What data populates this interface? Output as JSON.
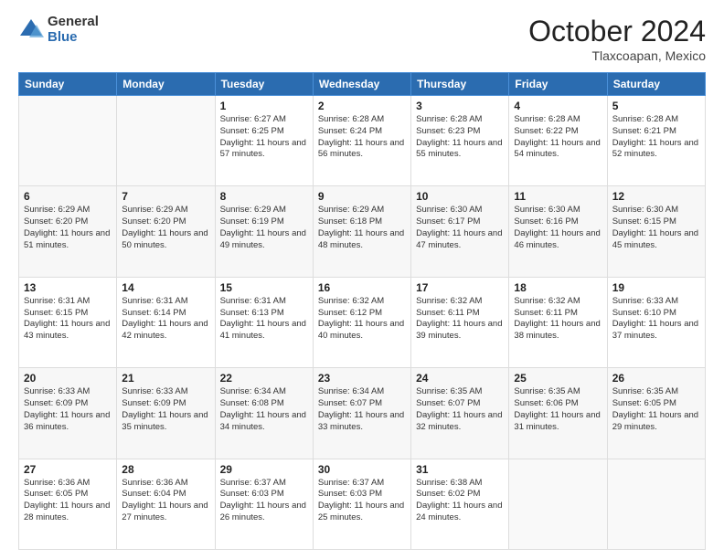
{
  "logo": {
    "general": "General",
    "blue": "Blue"
  },
  "header": {
    "month": "October 2024",
    "location": "Tlaxcoapan, Mexico"
  },
  "weekdays": [
    "Sunday",
    "Monday",
    "Tuesday",
    "Wednesday",
    "Thursday",
    "Friday",
    "Saturday"
  ],
  "weeks": [
    [
      {
        "day": "",
        "info": ""
      },
      {
        "day": "",
        "info": ""
      },
      {
        "day": "1",
        "info": "Sunrise: 6:27 AM\nSunset: 6:25 PM\nDaylight: 11 hours and 57 minutes."
      },
      {
        "day": "2",
        "info": "Sunrise: 6:28 AM\nSunset: 6:24 PM\nDaylight: 11 hours and 56 minutes."
      },
      {
        "day": "3",
        "info": "Sunrise: 6:28 AM\nSunset: 6:23 PM\nDaylight: 11 hours and 55 minutes."
      },
      {
        "day": "4",
        "info": "Sunrise: 6:28 AM\nSunset: 6:22 PM\nDaylight: 11 hours and 54 minutes."
      },
      {
        "day": "5",
        "info": "Sunrise: 6:28 AM\nSunset: 6:21 PM\nDaylight: 11 hours and 52 minutes."
      }
    ],
    [
      {
        "day": "6",
        "info": "Sunrise: 6:29 AM\nSunset: 6:20 PM\nDaylight: 11 hours and 51 minutes."
      },
      {
        "day": "7",
        "info": "Sunrise: 6:29 AM\nSunset: 6:20 PM\nDaylight: 11 hours and 50 minutes."
      },
      {
        "day": "8",
        "info": "Sunrise: 6:29 AM\nSunset: 6:19 PM\nDaylight: 11 hours and 49 minutes."
      },
      {
        "day": "9",
        "info": "Sunrise: 6:29 AM\nSunset: 6:18 PM\nDaylight: 11 hours and 48 minutes."
      },
      {
        "day": "10",
        "info": "Sunrise: 6:30 AM\nSunset: 6:17 PM\nDaylight: 11 hours and 47 minutes."
      },
      {
        "day": "11",
        "info": "Sunrise: 6:30 AM\nSunset: 6:16 PM\nDaylight: 11 hours and 46 minutes."
      },
      {
        "day": "12",
        "info": "Sunrise: 6:30 AM\nSunset: 6:15 PM\nDaylight: 11 hours and 45 minutes."
      }
    ],
    [
      {
        "day": "13",
        "info": "Sunrise: 6:31 AM\nSunset: 6:15 PM\nDaylight: 11 hours and 43 minutes."
      },
      {
        "day": "14",
        "info": "Sunrise: 6:31 AM\nSunset: 6:14 PM\nDaylight: 11 hours and 42 minutes."
      },
      {
        "day": "15",
        "info": "Sunrise: 6:31 AM\nSunset: 6:13 PM\nDaylight: 11 hours and 41 minutes."
      },
      {
        "day": "16",
        "info": "Sunrise: 6:32 AM\nSunset: 6:12 PM\nDaylight: 11 hours and 40 minutes."
      },
      {
        "day": "17",
        "info": "Sunrise: 6:32 AM\nSunset: 6:11 PM\nDaylight: 11 hours and 39 minutes."
      },
      {
        "day": "18",
        "info": "Sunrise: 6:32 AM\nSunset: 6:11 PM\nDaylight: 11 hours and 38 minutes."
      },
      {
        "day": "19",
        "info": "Sunrise: 6:33 AM\nSunset: 6:10 PM\nDaylight: 11 hours and 37 minutes."
      }
    ],
    [
      {
        "day": "20",
        "info": "Sunrise: 6:33 AM\nSunset: 6:09 PM\nDaylight: 11 hours and 36 minutes."
      },
      {
        "day": "21",
        "info": "Sunrise: 6:33 AM\nSunset: 6:09 PM\nDaylight: 11 hours and 35 minutes."
      },
      {
        "day": "22",
        "info": "Sunrise: 6:34 AM\nSunset: 6:08 PM\nDaylight: 11 hours and 34 minutes."
      },
      {
        "day": "23",
        "info": "Sunrise: 6:34 AM\nSunset: 6:07 PM\nDaylight: 11 hours and 33 minutes."
      },
      {
        "day": "24",
        "info": "Sunrise: 6:35 AM\nSunset: 6:07 PM\nDaylight: 11 hours and 32 minutes."
      },
      {
        "day": "25",
        "info": "Sunrise: 6:35 AM\nSunset: 6:06 PM\nDaylight: 11 hours and 31 minutes."
      },
      {
        "day": "26",
        "info": "Sunrise: 6:35 AM\nSunset: 6:05 PM\nDaylight: 11 hours and 29 minutes."
      }
    ],
    [
      {
        "day": "27",
        "info": "Sunrise: 6:36 AM\nSunset: 6:05 PM\nDaylight: 11 hours and 28 minutes."
      },
      {
        "day": "28",
        "info": "Sunrise: 6:36 AM\nSunset: 6:04 PM\nDaylight: 11 hours and 27 minutes."
      },
      {
        "day": "29",
        "info": "Sunrise: 6:37 AM\nSunset: 6:03 PM\nDaylight: 11 hours and 26 minutes."
      },
      {
        "day": "30",
        "info": "Sunrise: 6:37 AM\nSunset: 6:03 PM\nDaylight: 11 hours and 25 minutes."
      },
      {
        "day": "31",
        "info": "Sunrise: 6:38 AM\nSunset: 6:02 PM\nDaylight: 11 hours and 24 minutes."
      },
      {
        "day": "",
        "info": ""
      },
      {
        "day": "",
        "info": ""
      }
    ]
  ]
}
